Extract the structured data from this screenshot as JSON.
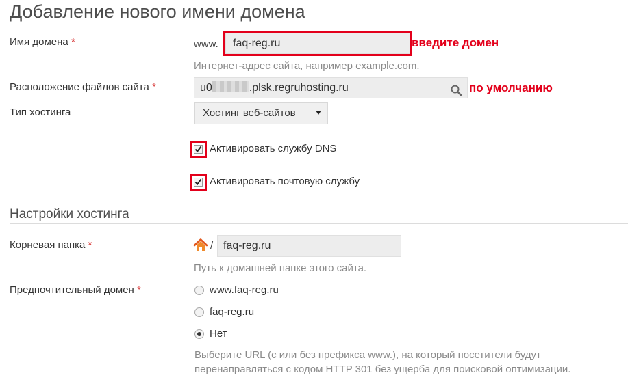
{
  "page": {
    "title": "Добавление нового имени домена"
  },
  "domain_name": {
    "label": "Имя домена",
    "required_mark": "*",
    "prefix": "www.",
    "value": "faq-reg.ru",
    "hint": "Интернет-адрес сайта, например example.com.",
    "annotation": "введите домен"
  },
  "files_location": {
    "label": "Расположение файлов сайта",
    "required_mark": "*",
    "value_start": "u0",
    "value_end": ".plsk.regruhosting.ru",
    "annotation": "по умолчанию"
  },
  "hosting_type": {
    "label": "Тип хостинга",
    "selected": "Хостинг веб-сайтов"
  },
  "options": {
    "dns_label": "Активировать службу DNS",
    "dns_checked": true,
    "mail_label": "Активировать почтовую службу",
    "mail_checked": true
  },
  "hosting_settings": {
    "section_title": "Настройки хостинга",
    "root_folder": {
      "label": "Корневая папка",
      "required_mark": "*",
      "separator": "/",
      "value": "faq-reg.ru",
      "hint": "Путь к домашней папке этого сайта."
    },
    "preferred_domain": {
      "label": "Предпочтительный домен",
      "required_mark": "*",
      "options": [
        "www.faq-reg.ru",
        "faq-reg.ru",
        "Нет"
      ],
      "selected_index": 2,
      "hint_line1": "Выберите URL (с или без префикса www.), на который посетители будут",
      "hint_line2": "перенаправляться с кодом HTTP 301 без ущерба для поисковой оптимизации."
    }
  },
  "colors": {
    "annotation": "#e3001b",
    "required": "#d63131",
    "field_bg": "#ededed"
  }
}
